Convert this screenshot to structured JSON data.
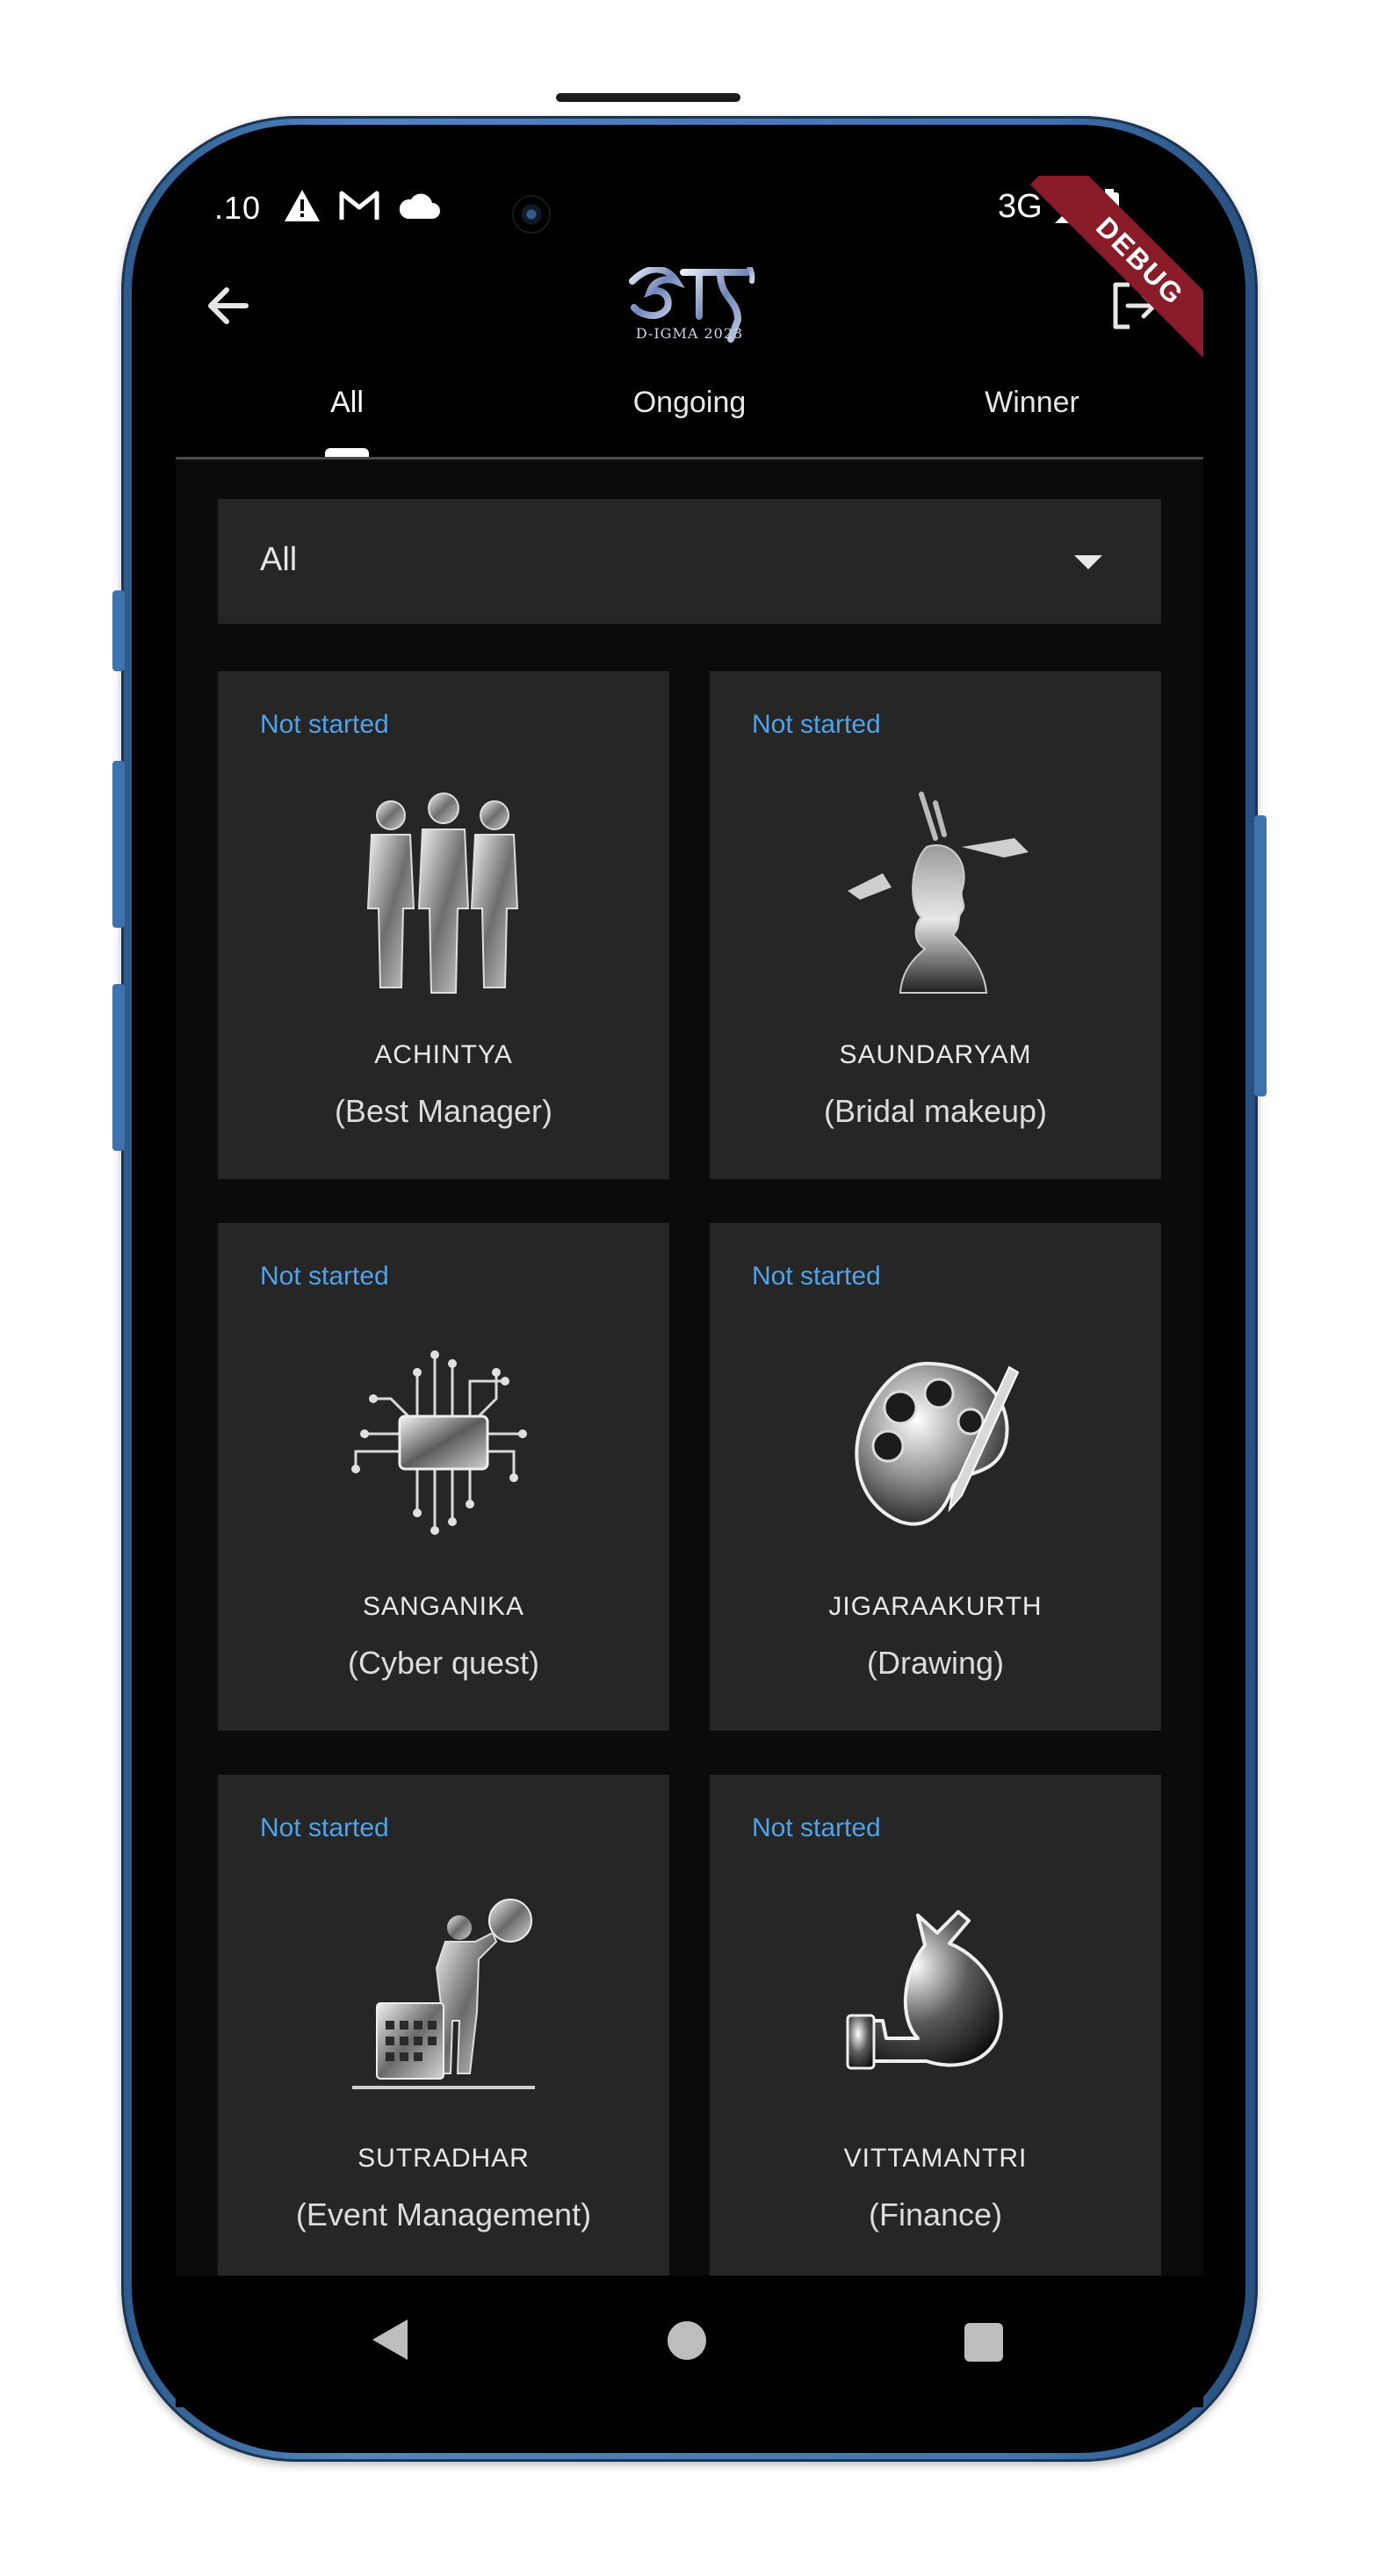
{
  "status_bar": {
    "time": ".10",
    "network": "3G",
    "debug_label": "DEBUG"
  },
  "app_bar": {
    "logo_text": "D-IGMA 2023"
  },
  "tabs": [
    {
      "label": "All"
    },
    {
      "label": "Ongoing"
    },
    {
      "label": "Winner"
    }
  ],
  "filter": {
    "selected": "All"
  },
  "events": [
    {
      "status": "Not started",
      "name": "ACHINTYA",
      "subtitle": "(Best Manager)",
      "icon": "people-silhouette-icon"
    },
    {
      "status": "Not started",
      "name": "SAUNDARYAM",
      "subtitle": "(Bridal makeup)",
      "icon": "makeup-silhouette-icon"
    },
    {
      "status": "Not started",
      "name": "SANGANIKA",
      "subtitle": "(Cyber quest)",
      "icon": "chip-icon"
    },
    {
      "status": "Not started",
      "name": "JIGARAAKURTH",
      "subtitle": "(Drawing)",
      "icon": "palette-icon"
    },
    {
      "status": "Not started",
      "name": "SUTRADHAR",
      "subtitle": "(Event Management)",
      "icon": "event-planner-icon"
    },
    {
      "status": "Not started",
      "name": "VITTAMANTRI",
      "subtitle": "(Finance)",
      "icon": "money-bag-icon"
    }
  ],
  "colors": {
    "status_text": "#4fa3e8",
    "card_bg": "#262626",
    "screen_bg": "#0b0b0b",
    "frame": "#3f75b0",
    "debug_ribbon": "#8a1c28"
  }
}
